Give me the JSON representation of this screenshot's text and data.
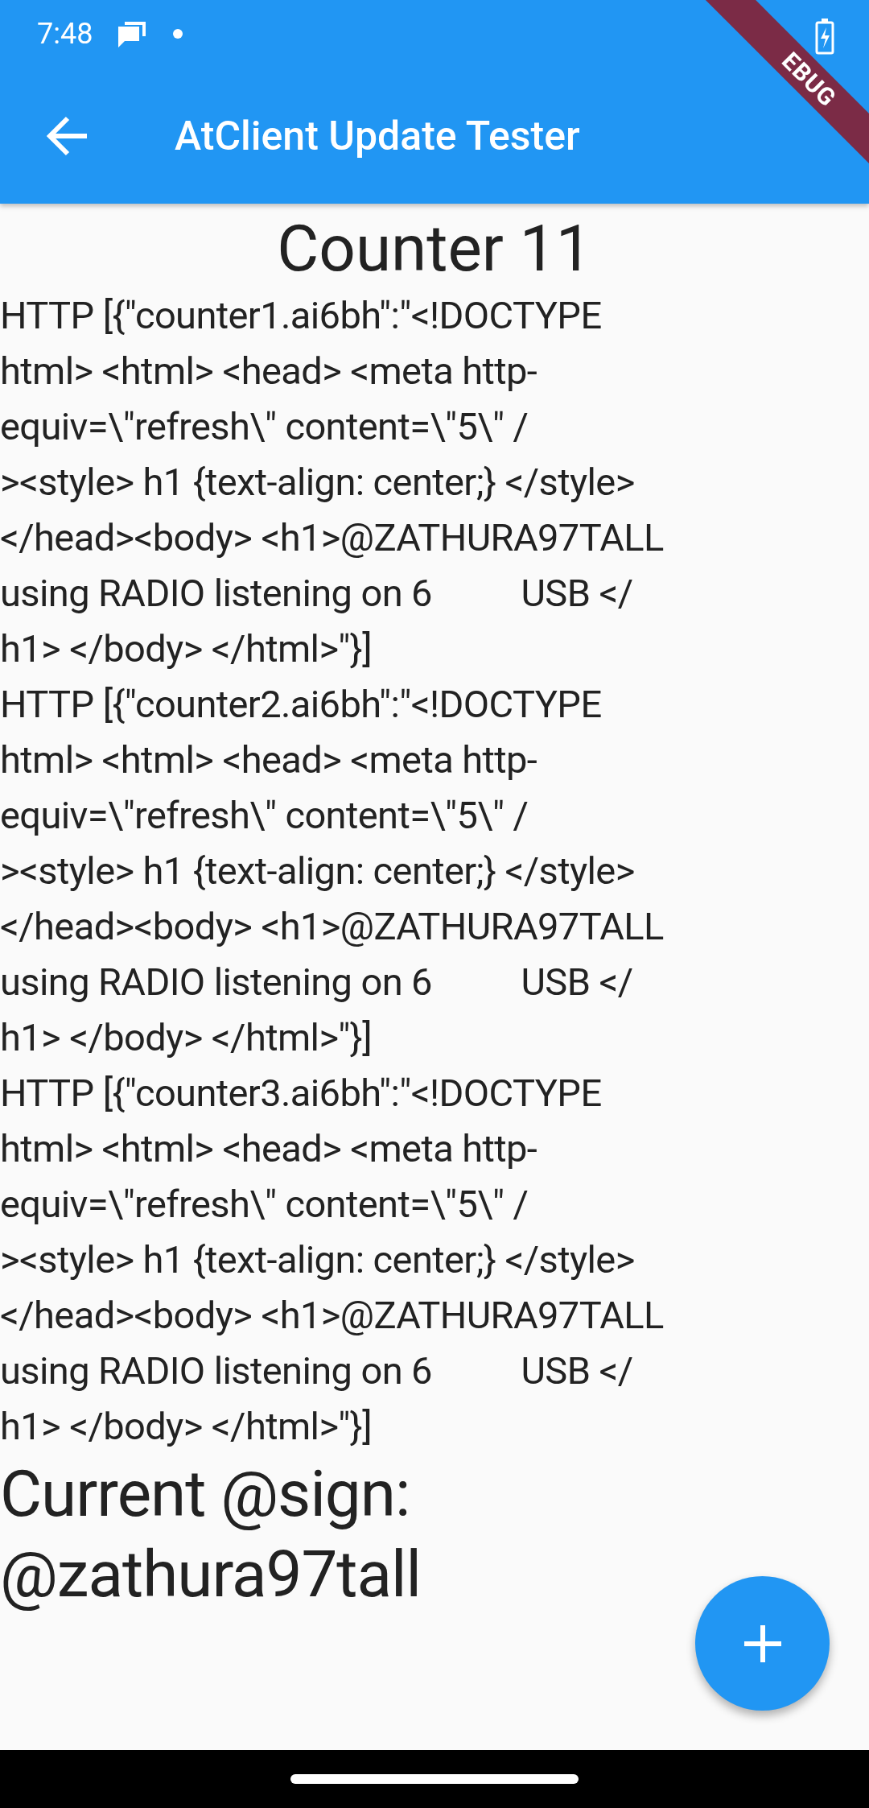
{
  "status_bar": {
    "time": "7:48",
    "debug_banner": "EBUG"
  },
  "app_bar": {
    "title": "AtClient Update Tester"
  },
  "counter": "Counter 11",
  "responses": [
    {
      "lines": [
        "HTTP [{\"counter1.ai6bh\":\"<!DOCTYPE",
        "html> <html> <head> <meta http-",
        "equiv=\\\"refresh\\\" content=\\\"5\\\" /",
        "><style> h1 {text-align: center;} </style>",
        "</head><body> <h1>@ZATHURA97TALL",
        "using RADIO listening on 6          USB </",
        "h1> </body> </html>\"}]"
      ]
    },
    {
      "lines": [
        "HTTP [{\"counter2.ai6bh\":\"<!DOCTYPE",
        "html> <html> <head> <meta http-",
        "equiv=\\\"refresh\\\" content=\\\"5\\\" /",
        "><style> h1 {text-align: center;} </style>",
        "</head><body> <h1>@ZATHURA97TALL",
        "using RADIO listening on 6          USB </",
        "h1> </body> </html>\"}]"
      ]
    },
    {
      "lines": [
        "HTTP [{\"counter3.ai6bh\":\"<!DOCTYPE",
        "html> <html> <head> <meta http-",
        "equiv=\\\"refresh\\\" content=\\\"5\\\" /",
        "><style> h1 {text-align: center;} </style>",
        "</head><body> <h1>@ZATHURA97TALL",
        "using RADIO listening on 6          USB </",
        "h1> </body> </html>\"}]"
      ]
    }
  ],
  "current_sign": {
    "lines": [
      "Current @sign:",
      "@zathura97tall"
    ]
  }
}
